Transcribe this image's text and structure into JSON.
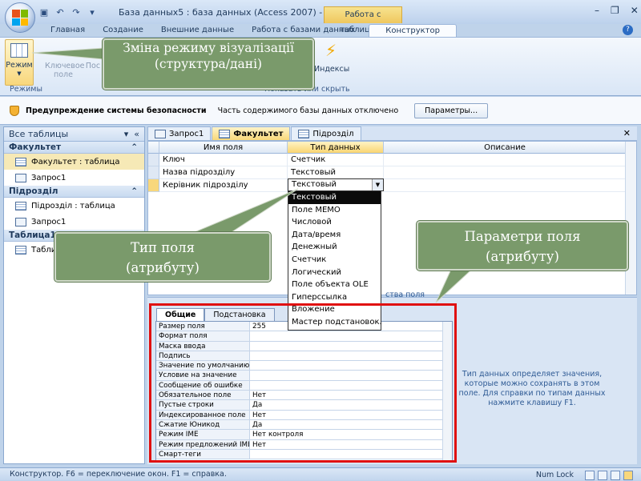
{
  "window": {
    "title": "База данных5 : база данных (Access 2007) - Microsoft ...",
    "context_tab": "Работа с таблицами",
    "controls": [
      "–",
      "❐",
      "✕"
    ]
  },
  "ribbon": {
    "tabs": [
      "Главная",
      "Создание",
      "Внешние данные",
      "Работа с базами данных",
      "Конструктор"
    ],
    "active_tab": "Конструктор",
    "buttons": {
      "mode": "Режим",
      "key_field_1": "Ключевое",
      "key_field_2": "поле",
      "build": "Пос",
      "indexes": "Индексы"
    },
    "groups": {
      "modes": "Режимы",
      "show_hide": "Показать или скрыть"
    }
  },
  "security_bar": {
    "title": "Предупреждение системы безопасности",
    "message": "Часть содержимого базы данных отключено",
    "button": "Параметры..."
  },
  "nav": {
    "header": "Все таблицы",
    "groups": [
      {
        "name": "Факультет",
        "items": [
          "Факультет : таблица",
          "Запрос1"
        ]
      },
      {
        "name": "Підрозділ",
        "items": [
          "Підрозділ : таблица",
          "Запрос1"
        ]
      },
      {
        "name": "Таблица1",
        "items": [
          "Табли"
        ]
      }
    ]
  },
  "doc_tabs": [
    "Запрос1",
    "Факультет",
    "Підрозділ"
  ],
  "active_doc_tab": "Факультет",
  "grid": {
    "headers": [
      "Имя поля",
      "Тип данных",
      "Описание"
    ],
    "rows": [
      {
        "name": "Ключ",
        "type": "Счетчик"
      },
      {
        "name": "Назва підрозділу",
        "type": "Текстовый"
      },
      {
        "name": "Керівник підрозділу",
        "type": "Текстовый"
      }
    ],
    "props_caption": "ства поля"
  },
  "dropdown": {
    "options": [
      "Текстовый",
      "Поле MEMO",
      "Числовой",
      "Дата/время",
      "Денежный",
      "Счетчик",
      "Логический",
      "Поле объекта OLE",
      "Гиперссылка",
      "Вложение",
      "Мастер подстановок."
    ],
    "selected": "Текстовый"
  },
  "props": {
    "tabs": [
      "Общие",
      "Подстановка"
    ],
    "rows": [
      {
        "name": "Размер поля",
        "value": "255"
      },
      {
        "name": "Формат поля",
        "value": ""
      },
      {
        "name": "Маска ввода",
        "value": ""
      },
      {
        "name": "Подпись",
        "value": ""
      },
      {
        "name": "Значение по умолчанию",
        "value": ""
      },
      {
        "name": "Условие на значение",
        "value": ""
      },
      {
        "name": "Сообщение об ошибке",
        "value": ""
      },
      {
        "name": "Обязательное поле",
        "value": "Нет"
      },
      {
        "name": "Пустые строки",
        "value": "Да"
      },
      {
        "name": "Индексированное поле",
        "value": "Нет"
      },
      {
        "name": "Сжатие Юникод",
        "value": "Да"
      },
      {
        "name": "Режим IME",
        "value": "Нет контроля"
      },
      {
        "name": "Режим предложений IME",
        "value": "Нет"
      },
      {
        "name": "Смарт-теги",
        "value": ""
      }
    ],
    "hint": "Тип данных определяет значения, которые можно сохранять в этом поле.  Для справки по типам данных нажмите клавишу F1."
  },
  "status": {
    "text": "Конструктор.  F6 = переключение окон.  F1 = справка.",
    "numlock": "Num Lock"
  },
  "callouts": {
    "view_mode": "Зміна режиму візуалізації (структура/дані)",
    "field_type": "Тип поля (атрибуту)",
    "field_params": "Параметри поля (атрибуту)"
  },
  "colors": {
    "callout_bg": "#7a9a6b",
    "highlight_box": "#e01010",
    "active_tab": "#f8d87a"
  }
}
